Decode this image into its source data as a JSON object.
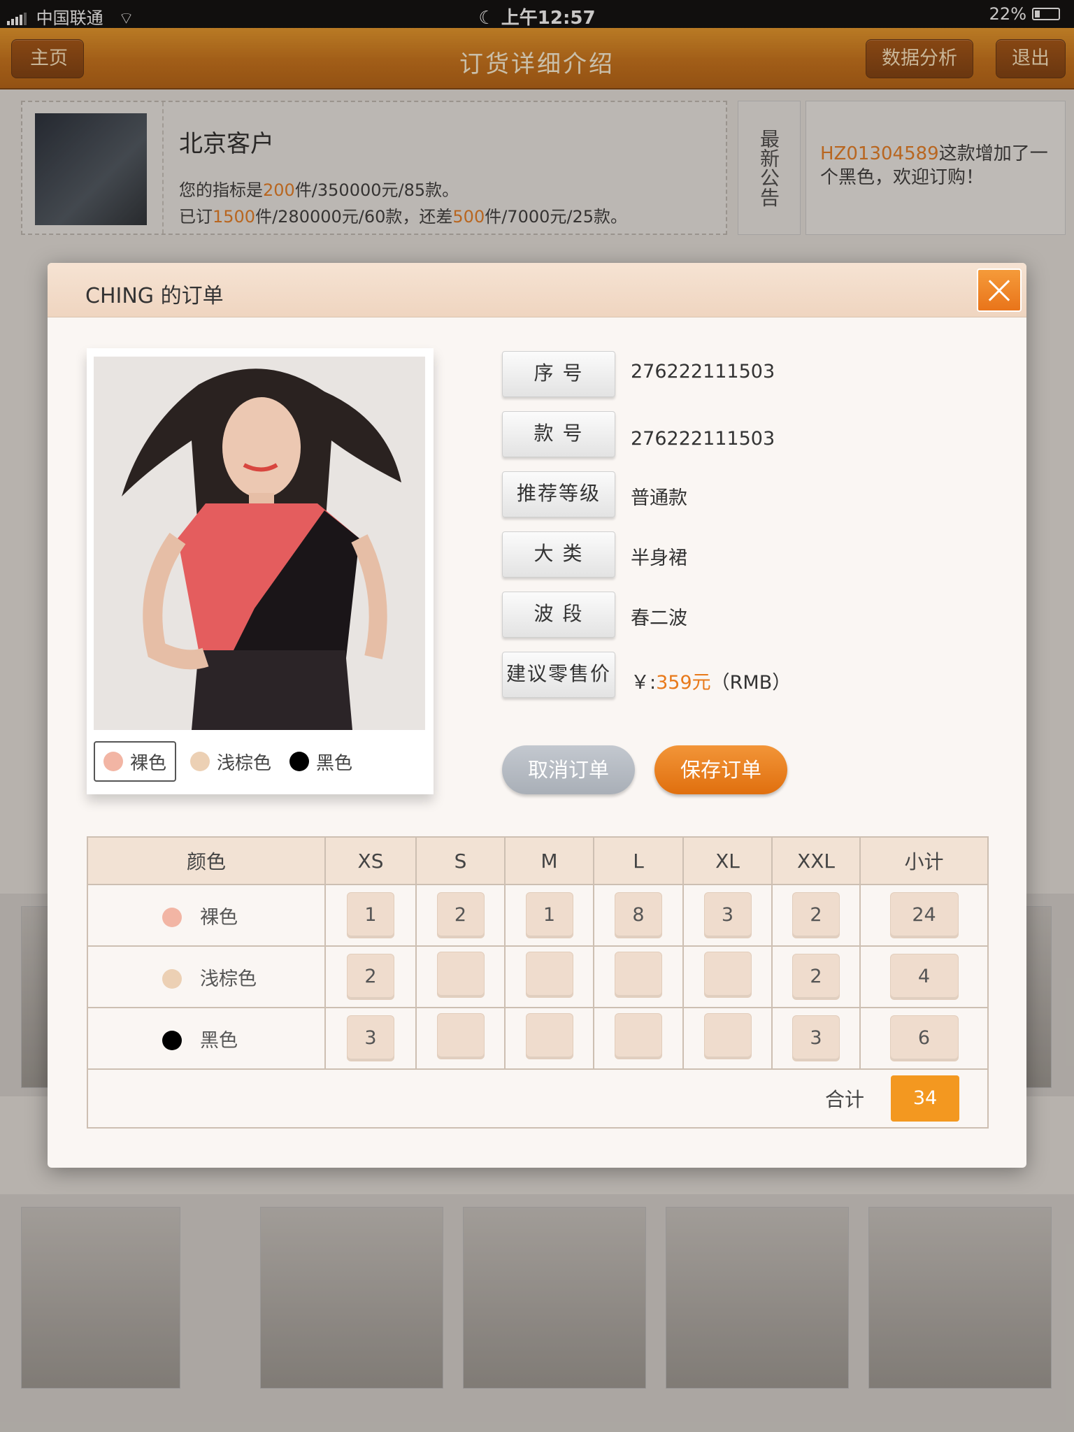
{
  "status": {
    "carrier": "中国联通",
    "time": "上午12:57",
    "battery": "22%"
  },
  "nav": {
    "back": "主页",
    "title": "订货详细介绍",
    "analysis": "数据分析",
    "exit": "退出"
  },
  "customer": {
    "name": "北京客户",
    "l1": {
      "a": "您的指标是",
      "b": "200",
      "c": "件/350000元/85款。"
    },
    "l2": {
      "a": "已订",
      "b": "1500",
      "c": "件/280000元/60款，还差",
      "d": "500",
      "e": "件/7000元/25款。"
    }
  },
  "notice": {
    "tab": "最新公告",
    "code": "HZ01304589",
    "text": "这款增加了一个黑色，欢迎订购！"
  },
  "modal": {
    "title": "CHING 的订单",
    "swatches": [
      {
        "label": "裸色",
        "color": "#f2b5a4"
      },
      {
        "label": "浅棕色",
        "color": "#ecd0b4"
      },
      {
        "label": "黑色",
        "color": "#000000"
      }
    ],
    "fields": [
      {
        "label": "序 号",
        "value": "276222111503"
      },
      {
        "label": "款 号",
        "value": "276222111503"
      },
      {
        "label": "推荐等级",
        "value": "普通款"
      },
      {
        "label": "大 类",
        "value": "半身裙"
      },
      {
        "label": "波 段",
        "value": "春二波"
      },
      {
        "label": "建议零售价",
        "value_prefix": "￥:",
        "value_price": "359元",
        "value_suffix": "（RMB）"
      }
    ],
    "cancel": "取消订单",
    "save": "保存订单"
  },
  "table": {
    "headers": [
      "颜色",
      "XS",
      "S",
      "M",
      "L",
      "XL",
      "XXL",
      "小计"
    ],
    "rows": [
      {
        "color": "裸色",
        "dot": "#f2b5a4",
        "qty": [
          "1",
          "2",
          "1",
          "8",
          "3",
          "2"
        ],
        "subtotal": "24"
      },
      {
        "color": "浅棕色",
        "dot": "#ecd0b4",
        "qty": [
          "2",
          "",
          "",
          "",
          "",
          "2"
        ],
        "subtotal": "4"
      },
      {
        "color": "黑色",
        "dot": "#000000",
        "qty": [
          "3",
          "",
          "",
          "",
          "",
          "3"
        ],
        "subtotal": "6"
      }
    ],
    "total_label": "合计",
    "total": "34"
  },
  "colors": {
    "accent": "#e8791a",
    "nav": "#c86d0e",
    "total": "#f39820"
  }
}
